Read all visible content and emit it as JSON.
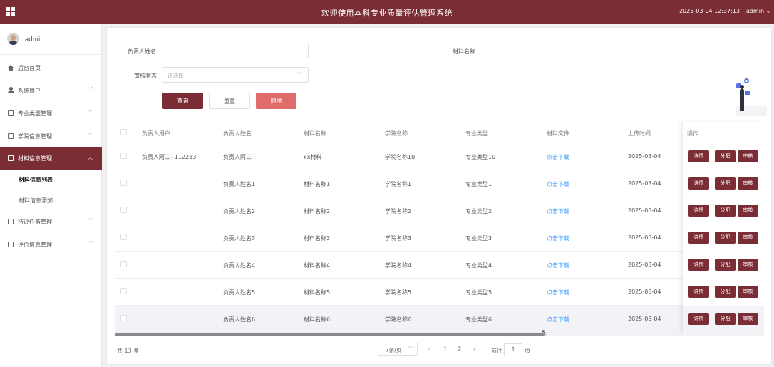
{
  "header": {
    "title": "欢迎使用本科专业质量评估管理系统",
    "datetime": "2025-03-04 12:37:13",
    "user": "admin ⌄"
  },
  "sidebar": {
    "username": "admin",
    "items": [
      {
        "label": "后台首页"
      },
      {
        "label": "系统用户"
      },
      {
        "label": "专业类型管理"
      },
      {
        "label": "学院信息管理"
      },
      {
        "label": "材料信息管理"
      },
      {
        "label": "待评任务管理"
      },
      {
        "label": "评价信息管理"
      }
    ],
    "subitems": [
      {
        "label": "材料信息列表"
      },
      {
        "label": "材料信息添加"
      }
    ]
  },
  "filters": {
    "owner_label": "负责人姓名",
    "owner_value": "",
    "material_label": "材料名称",
    "material_value": "",
    "status_label": "审核状态",
    "status_placeholder": "请选择"
  },
  "buttons": {
    "query": "查询",
    "reset": "重置",
    "delete": "删除"
  },
  "table": {
    "columns": [
      "负责人用户",
      "负责人姓名",
      "材料名称",
      "学院名称",
      "专业类型",
      "材料文件",
      "上传时间",
      "操作"
    ],
    "op_labels": {
      "detail": "详情",
      "assign": "分配",
      "review": "审核"
    },
    "rows": [
      {
        "user": "负责人阿三--112233",
        "name": "负责人阿三",
        "material": "xx材料",
        "college": "学院名称10",
        "major": "专业类型10",
        "file": "点击下载",
        "time": "2025-03-04"
      },
      {
        "user": "",
        "name": "负责人姓名1",
        "material": "材料名称1",
        "college": "学院名称1",
        "major": "专业类型1",
        "file": "点击下载",
        "time": "2025-03-04"
      },
      {
        "user": "",
        "name": "负责人姓名2",
        "material": "材料名称2",
        "college": "学院名称2",
        "major": "专业类型2",
        "file": "点击下载",
        "time": "2025-03-04"
      },
      {
        "user": "",
        "name": "负责人姓名3",
        "material": "材料名称3",
        "college": "学院名称3",
        "major": "专业类型3",
        "file": "点击下载",
        "time": "2025-03-04"
      },
      {
        "user": "",
        "name": "负责人姓名4",
        "material": "材料名称4",
        "college": "学院名称4",
        "major": "专业类型4",
        "file": "点击下载",
        "time": "2025-03-04"
      },
      {
        "user": "",
        "name": "负责人姓名5",
        "material": "材料名称5",
        "college": "学院名称5",
        "major": "专业类型5",
        "file": "点击下载",
        "time": "2025-03-04"
      },
      {
        "user": "",
        "name": "负责人姓名6",
        "material": "材料名称6",
        "college": "学院名称6",
        "major": "专业类型6",
        "file": "点击下载",
        "time": "2025-03-04"
      }
    ]
  },
  "pagination": {
    "total": "共 13 条",
    "page_size": "7条/页",
    "pages": [
      "1",
      "2"
    ],
    "current": "1",
    "goto_label": "前往",
    "goto_value": "1",
    "page_suffix": "页"
  },
  "colors": {
    "primary": "#7b2d35",
    "danger": "#e06b6b",
    "link": "#409eff"
  }
}
